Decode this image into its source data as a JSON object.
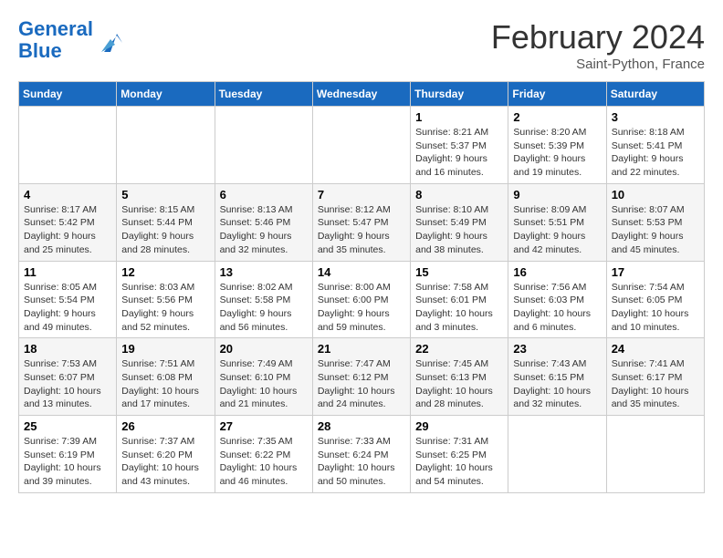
{
  "header": {
    "logo_line1": "General",
    "logo_line2": "Blue",
    "month": "February 2024",
    "location": "Saint-Python, France"
  },
  "weekdays": [
    "Sunday",
    "Monday",
    "Tuesday",
    "Wednesday",
    "Thursday",
    "Friday",
    "Saturday"
  ],
  "weeks": [
    [
      {
        "day": "",
        "info": ""
      },
      {
        "day": "",
        "info": ""
      },
      {
        "day": "",
        "info": ""
      },
      {
        "day": "",
        "info": ""
      },
      {
        "day": "1",
        "info": "Sunrise: 8:21 AM\nSunset: 5:37 PM\nDaylight: 9 hours\nand 16 minutes."
      },
      {
        "day": "2",
        "info": "Sunrise: 8:20 AM\nSunset: 5:39 PM\nDaylight: 9 hours\nand 19 minutes."
      },
      {
        "day": "3",
        "info": "Sunrise: 8:18 AM\nSunset: 5:41 PM\nDaylight: 9 hours\nand 22 minutes."
      }
    ],
    [
      {
        "day": "4",
        "info": "Sunrise: 8:17 AM\nSunset: 5:42 PM\nDaylight: 9 hours\nand 25 minutes."
      },
      {
        "day": "5",
        "info": "Sunrise: 8:15 AM\nSunset: 5:44 PM\nDaylight: 9 hours\nand 28 minutes."
      },
      {
        "day": "6",
        "info": "Sunrise: 8:13 AM\nSunset: 5:46 PM\nDaylight: 9 hours\nand 32 minutes."
      },
      {
        "day": "7",
        "info": "Sunrise: 8:12 AM\nSunset: 5:47 PM\nDaylight: 9 hours\nand 35 minutes."
      },
      {
        "day": "8",
        "info": "Sunrise: 8:10 AM\nSunset: 5:49 PM\nDaylight: 9 hours\nand 38 minutes."
      },
      {
        "day": "9",
        "info": "Sunrise: 8:09 AM\nSunset: 5:51 PM\nDaylight: 9 hours\nand 42 minutes."
      },
      {
        "day": "10",
        "info": "Sunrise: 8:07 AM\nSunset: 5:53 PM\nDaylight: 9 hours\nand 45 minutes."
      }
    ],
    [
      {
        "day": "11",
        "info": "Sunrise: 8:05 AM\nSunset: 5:54 PM\nDaylight: 9 hours\nand 49 minutes."
      },
      {
        "day": "12",
        "info": "Sunrise: 8:03 AM\nSunset: 5:56 PM\nDaylight: 9 hours\nand 52 minutes."
      },
      {
        "day": "13",
        "info": "Sunrise: 8:02 AM\nSunset: 5:58 PM\nDaylight: 9 hours\nand 56 minutes."
      },
      {
        "day": "14",
        "info": "Sunrise: 8:00 AM\nSunset: 6:00 PM\nDaylight: 9 hours\nand 59 minutes."
      },
      {
        "day": "15",
        "info": "Sunrise: 7:58 AM\nSunset: 6:01 PM\nDaylight: 10 hours\nand 3 minutes."
      },
      {
        "day": "16",
        "info": "Sunrise: 7:56 AM\nSunset: 6:03 PM\nDaylight: 10 hours\nand 6 minutes."
      },
      {
        "day": "17",
        "info": "Sunrise: 7:54 AM\nSunset: 6:05 PM\nDaylight: 10 hours\nand 10 minutes."
      }
    ],
    [
      {
        "day": "18",
        "info": "Sunrise: 7:53 AM\nSunset: 6:07 PM\nDaylight: 10 hours\nand 13 minutes."
      },
      {
        "day": "19",
        "info": "Sunrise: 7:51 AM\nSunset: 6:08 PM\nDaylight: 10 hours\nand 17 minutes."
      },
      {
        "day": "20",
        "info": "Sunrise: 7:49 AM\nSunset: 6:10 PM\nDaylight: 10 hours\nand 21 minutes."
      },
      {
        "day": "21",
        "info": "Sunrise: 7:47 AM\nSunset: 6:12 PM\nDaylight: 10 hours\nand 24 minutes."
      },
      {
        "day": "22",
        "info": "Sunrise: 7:45 AM\nSunset: 6:13 PM\nDaylight: 10 hours\nand 28 minutes."
      },
      {
        "day": "23",
        "info": "Sunrise: 7:43 AM\nSunset: 6:15 PM\nDaylight: 10 hours\nand 32 minutes."
      },
      {
        "day": "24",
        "info": "Sunrise: 7:41 AM\nSunset: 6:17 PM\nDaylight: 10 hours\nand 35 minutes."
      }
    ],
    [
      {
        "day": "25",
        "info": "Sunrise: 7:39 AM\nSunset: 6:19 PM\nDaylight: 10 hours\nand 39 minutes."
      },
      {
        "day": "26",
        "info": "Sunrise: 7:37 AM\nSunset: 6:20 PM\nDaylight: 10 hours\nand 43 minutes."
      },
      {
        "day": "27",
        "info": "Sunrise: 7:35 AM\nSunset: 6:22 PM\nDaylight: 10 hours\nand 46 minutes."
      },
      {
        "day": "28",
        "info": "Sunrise: 7:33 AM\nSunset: 6:24 PM\nDaylight: 10 hours\nand 50 minutes."
      },
      {
        "day": "29",
        "info": "Sunrise: 7:31 AM\nSunset: 6:25 PM\nDaylight: 10 hours\nand 54 minutes."
      },
      {
        "day": "",
        "info": ""
      },
      {
        "day": "",
        "info": ""
      }
    ]
  ]
}
